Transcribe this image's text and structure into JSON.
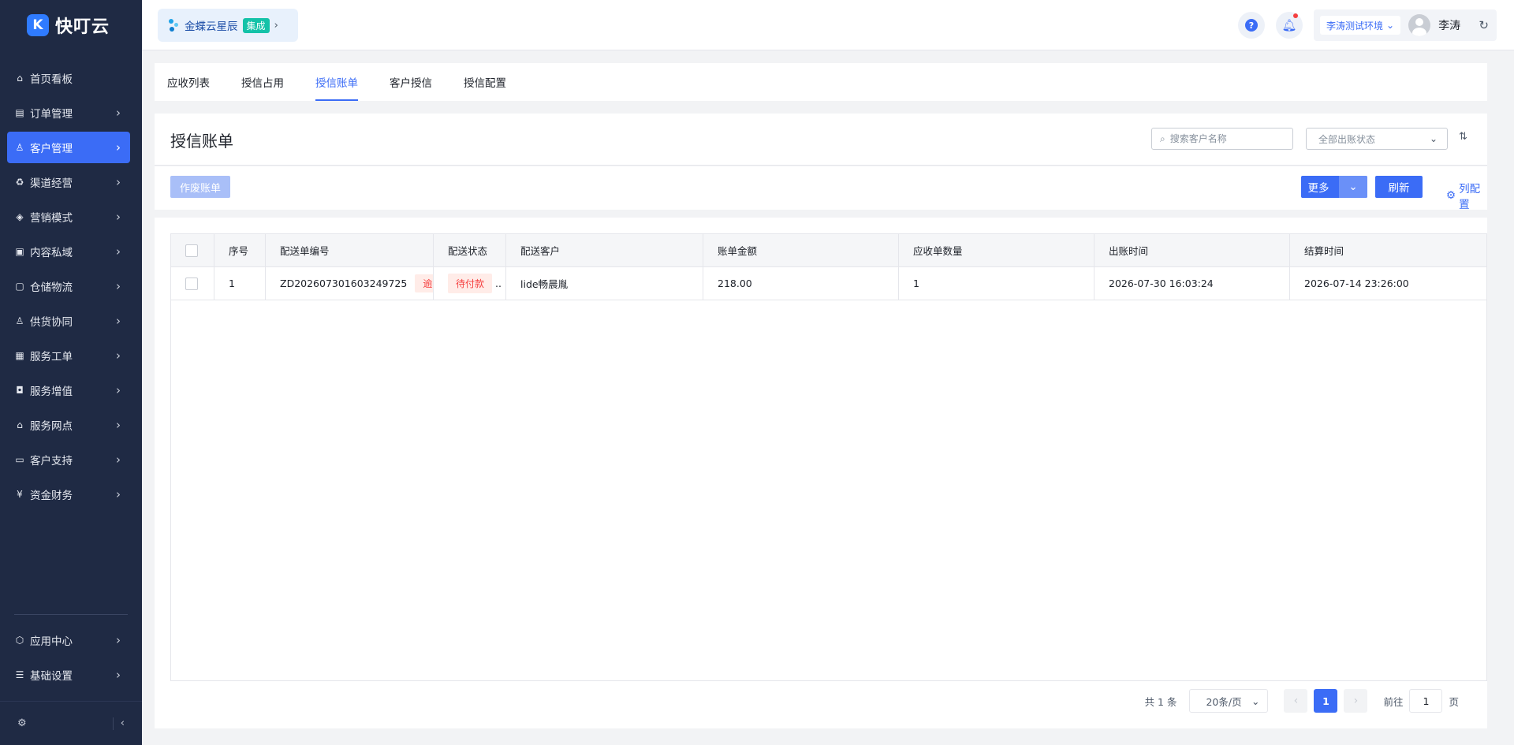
{
  "sidebar": {
    "logo_text": "快叮云",
    "items": [
      {
        "label": "首页看板",
        "icon": "home-icon",
        "has_arrow": false,
        "active": false
      },
      {
        "label": "订单管理",
        "icon": "order-icon",
        "has_arrow": true,
        "active": false
      },
      {
        "label": "客户管理",
        "icon": "user-icon",
        "has_arrow": true,
        "active": true
      },
      {
        "label": "渠道经营",
        "icon": "channel-icon",
        "has_arrow": true,
        "active": false
      },
      {
        "label": "营销模式",
        "icon": "tag-icon",
        "has_arrow": true,
        "active": false
      },
      {
        "label": "内容私域",
        "icon": "image-icon",
        "has_arrow": true,
        "active": false
      },
      {
        "label": "仓储物流",
        "icon": "warehouse-icon",
        "has_arrow": true,
        "active": false
      },
      {
        "label": "供货协同",
        "icon": "supply-icon",
        "has_arrow": true,
        "active": false
      },
      {
        "label": "服务工单",
        "icon": "ticket-icon",
        "has_arrow": true,
        "active": false
      },
      {
        "label": "服务增值",
        "icon": "bag-icon",
        "has_arrow": true,
        "active": false
      },
      {
        "label": "服务网点",
        "icon": "store-icon",
        "has_arrow": true,
        "active": false
      },
      {
        "label": "客户支持",
        "icon": "support-icon",
        "has_arrow": true,
        "active": false
      },
      {
        "label": "资金财务",
        "icon": "yen-icon",
        "has_arrow": true,
        "active": false
      }
    ],
    "bottom_items": [
      {
        "label": "应用中心",
        "icon": "cube-icon"
      },
      {
        "label": "基础设置",
        "icon": "sliders-icon"
      }
    ]
  },
  "header": {
    "app_name": "金蝶云星辰",
    "app_badge": "集成",
    "env_label": "李涛测试环境",
    "user_name": "李涛"
  },
  "tabs": [
    {
      "label": "应收列表",
      "active": false
    },
    {
      "label": "授信占用",
      "active": false
    },
    {
      "label": "授信账单",
      "active": true
    },
    {
      "label": "客户授信",
      "active": false
    },
    {
      "label": "授信配置",
      "active": false
    }
  ],
  "panel": {
    "title": "授信账单",
    "search_placeholder": "搜索客户名称",
    "status_filter": "全部出账状态"
  },
  "toolbar": {
    "void_label": "作废账单",
    "more_label": "更多",
    "refresh_label": "刷新",
    "col_config_label": "列配置"
  },
  "table": {
    "columns": [
      "序号",
      "配送单编号",
      "配送状态",
      "配送客户",
      "账单金额",
      "应收单数量",
      "出账时间",
      "结算时间"
    ],
    "rows": [
      {
        "index": "1",
        "order_no": "ZD202607301603249725",
        "overdue_tag": "逾",
        "status": "待付款",
        "status_more": "..",
        "customer": "lide畅晨胤",
        "amount": "218.00",
        "receivable_count": "1",
        "bill_time": "2026-07-30 16:03:24",
        "settle_time": "2026-07-14 23:26:00"
      }
    ]
  },
  "pagination": {
    "total_text": "共 1 条",
    "page_size": "20条/页",
    "current_page": "1",
    "goto_label": "前往",
    "goto_value": "1",
    "page_unit": "页"
  }
}
